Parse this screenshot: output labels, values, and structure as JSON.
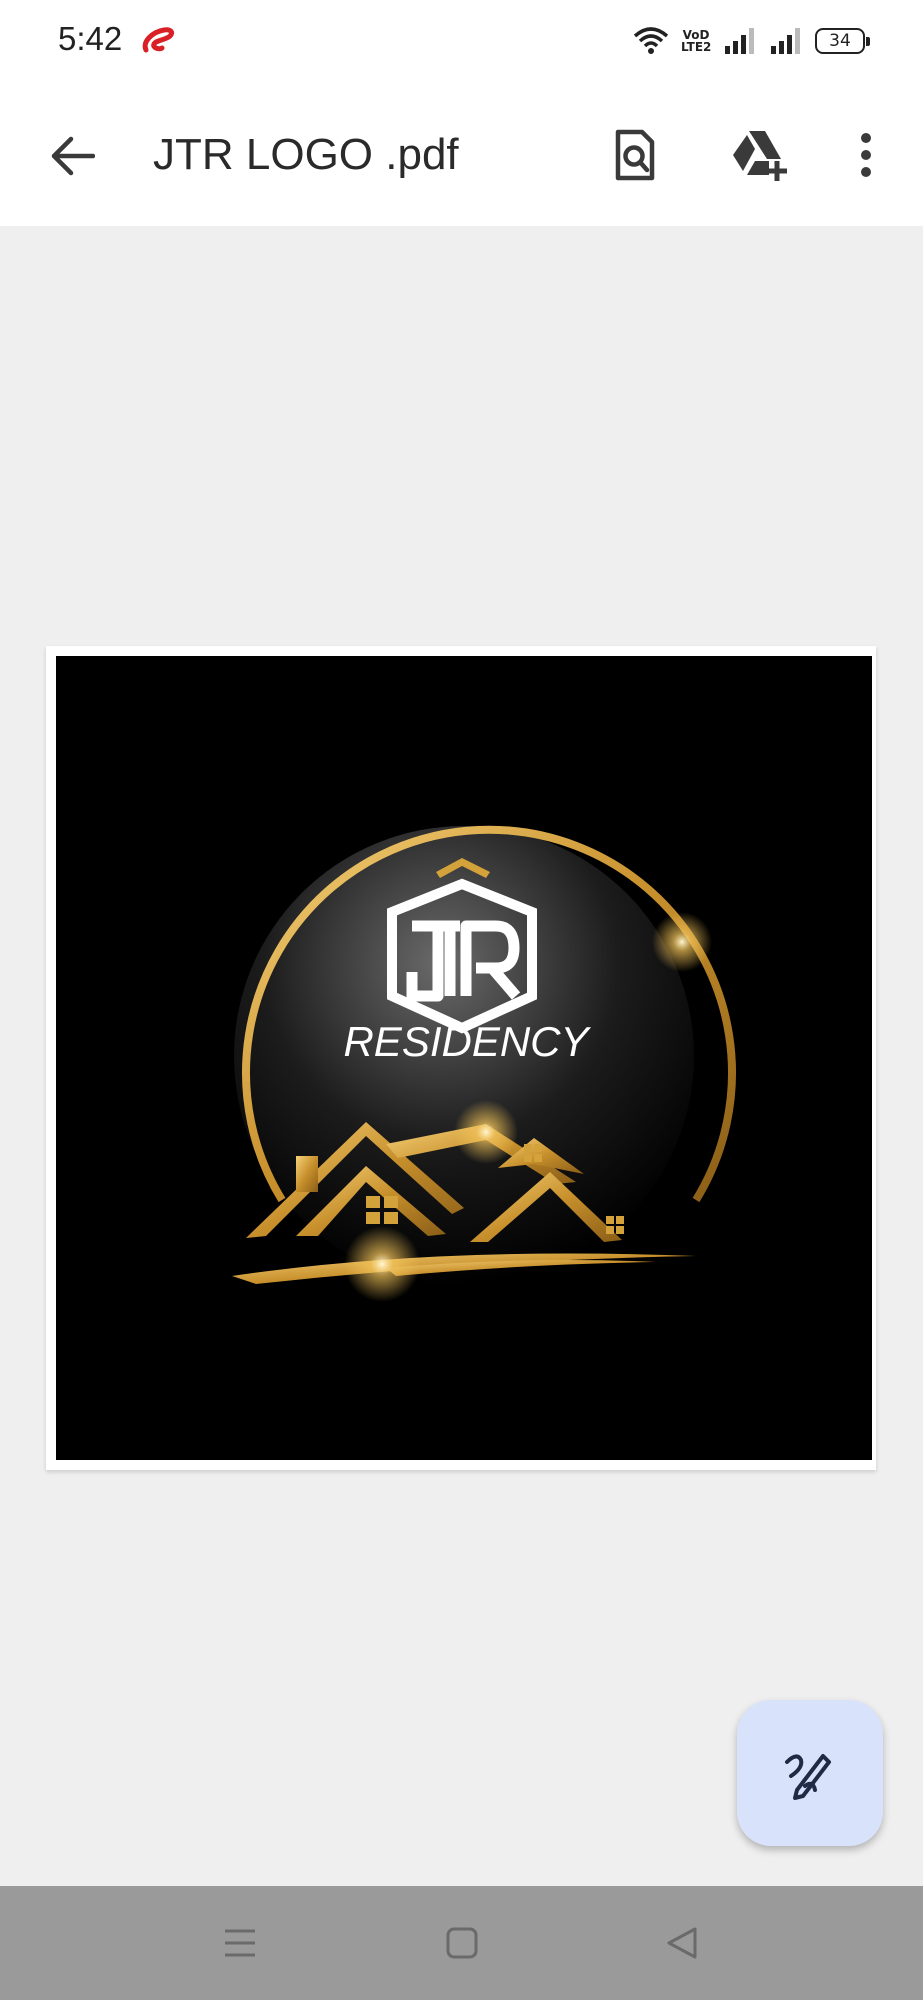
{
  "status_bar": {
    "time": "5:42",
    "volte_label_top": "VoD",
    "volte_label_bottom": "LTE2",
    "battery_level": "34",
    "icons": [
      "carrier-icon",
      "wifi-icon",
      "volte-icon",
      "signal-icon",
      "signal-icon",
      "battery-icon"
    ]
  },
  "app_bar": {
    "title": "JTR LOGO .pdf",
    "back_icon": "arrow-left-icon",
    "find_icon": "find-in-page-icon",
    "drive_icon": "add-to-drive-icon",
    "more_icon": "more-vert-icon"
  },
  "document": {
    "logo_text": "RESIDENCY",
    "logo_monogram": "JTR",
    "colors": {
      "gold": "#d4a23a",
      "background": "#000000"
    }
  },
  "fab": {
    "icon": "edit-pen-icon",
    "color": "#d8e3fb"
  },
  "nav_bar": {
    "icons": [
      "menu-icon",
      "home-square-icon",
      "back-triangle-icon"
    ]
  }
}
